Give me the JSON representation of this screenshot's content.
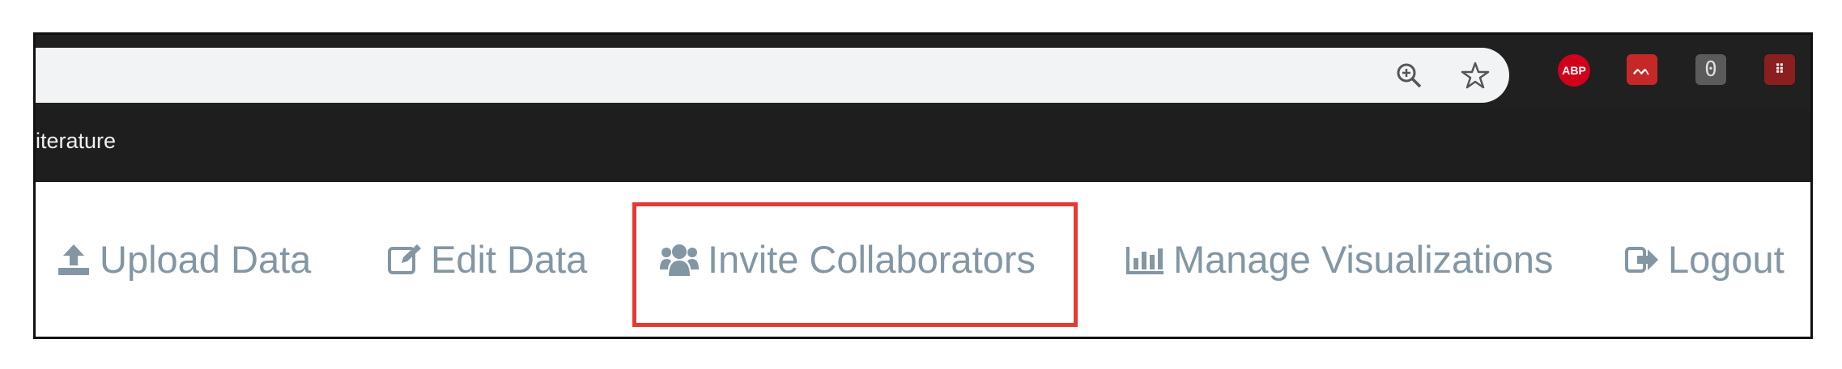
{
  "browser": {
    "bookmark_bar_text": "iterature",
    "extensions": {
      "adblock_label": "ABP",
      "red_ext_glyph": "ᨓ",
      "counter_value": "0",
      "pixel_ext_glyph": "⠿"
    }
  },
  "nav": {
    "items": [
      {
        "label": "Upload Data",
        "icon": "upload-icon"
      },
      {
        "label": "Edit Data",
        "icon": "edit-icon"
      },
      {
        "label": "Invite Collaborators",
        "icon": "users-icon"
      },
      {
        "label": "Manage Visualizations",
        "icon": "bar-chart-icon"
      },
      {
        "label": "Logout",
        "icon": "logout-icon"
      }
    ],
    "highlighted": "Invite Collaborators",
    "highlight_color": "#e53935",
    "text_color": "#8396a3"
  }
}
